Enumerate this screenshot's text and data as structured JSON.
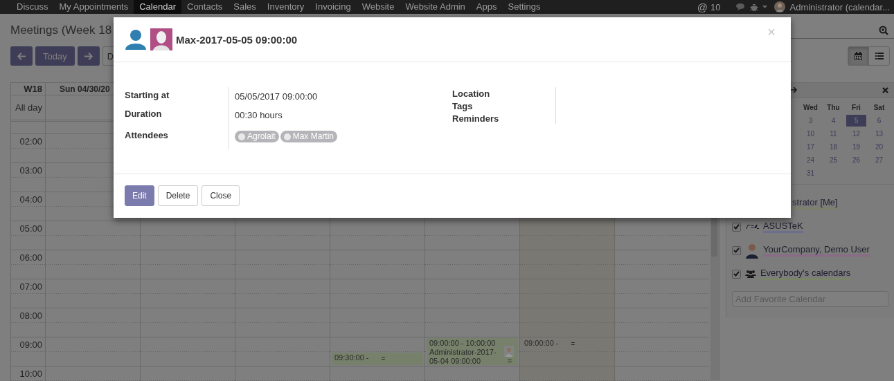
{
  "navbar": {
    "menu": [
      {
        "label": "Discuss",
        "selected": false
      },
      {
        "label": "My Appointments",
        "selected": false
      },
      {
        "label": "Calendar",
        "selected": true
      },
      {
        "label": "Contacts",
        "selected": false
      },
      {
        "label": "Sales",
        "selected": false
      },
      {
        "label": "Inventory",
        "selected": false
      },
      {
        "label": "Invoicing",
        "selected": false
      },
      {
        "label": "Website",
        "selected": false
      },
      {
        "label": "Website Admin",
        "selected": false
      },
      {
        "label": "Apps",
        "selected": false
      },
      {
        "label": "Settings",
        "selected": false
      }
    ],
    "mention_icon": "@",
    "mention_count": "10",
    "user": "Administrator (calendar..."
  },
  "control_panel": {
    "title": "Meetings (Week 18",
    "today": "Today",
    "scale": "D",
    "views": [
      {
        "kind": "calendar",
        "selected": true
      },
      {
        "kind": "list",
        "selected": false
      }
    ]
  },
  "calendar": {
    "week": "W18",
    "all_day": "All day",
    "days": [
      {
        "label": "Sun 04/30/20",
        "today": false
      },
      {
        "today": false
      },
      {
        "today": false
      },
      {
        "today": false,
        "events": [
          {
            "kind": "second-half",
            "time": "09:30:00 -",
            "handle": "=",
            "color": "#76806a"
          }
        ]
      },
      {
        "today": false,
        "events": [
          {
            "kind": "full-hour",
            "time": "09:00:00 - 10:00:00",
            "title": "Administrator-2017-05-04 09:00:00",
            "handle": "=",
            "avatar": true,
            "color": "#76806a"
          }
        ]
      },
      {
        "today": true,
        "events": [
          {
            "kind": "first-half",
            "time": "09:00:00 -",
            "handle": "="
          }
        ]
      },
      {
        "today": false
      }
    ],
    "hours": [
      "02:00",
      "03:00",
      "04:00",
      "05:00",
      "06:00",
      "07:00",
      "08:00",
      "09:00",
      "10:00"
    ]
  },
  "mini_calendar": {
    "headers": [
      "Wed",
      "Thu",
      "Fri",
      "Sat"
    ],
    "weeks": [
      [
        {
          "label": "3",
          "selected": false
        },
        {
          "label": "4",
          "selected": false
        },
        {
          "label": "5",
          "selected": true
        },
        {
          "label": "6",
          "selected": false
        }
      ],
      [
        {
          "label": "10",
          "selected": false
        },
        {
          "label": "11",
          "selected": false
        },
        {
          "label": "12",
          "selected": false
        },
        {
          "label": "13",
          "selected": false
        }
      ],
      [
        {
          "label": "17",
          "selected": false
        },
        {
          "label": "18",
          "selected": false
        },
        {
          "label": "19",
          "selected": false
        },
        {
          "label": "20",
          "selected": false
        }
      ],
      [
        {
          "label": "24",
          "selected": false
        },
        {
          "label": "25",
          "selected": false
        },
        {
          "label": "26",
          "selected": false
        },
        {
          "label": "27",
          "selected": false
        }
      ],
      [
        {
          "label": "31",
          "selected": false
        }
      ]
    ]
  },
  "filters": [
    {
      "kind": "me",
      "label": "strator [Me]",
      "color": "#7a8068"
    },
    {
      "kind": "logo",
      "label": "ASUSTeK",
      "checked": true,
      "color": "#6c6e8e"
    },
    {
      "kind": "avatar",
      "label": "YourCompany, Demo User",
      "checked": true,
      "color": "#8a6a86"
    },
    {
      "kind": "group",
      "label": "Everybody's calendars",
      "checked": true,
      "color": "#7a8466"
    }
  ],
  "favorite_placeholder": "Add Favorite Calendar",
  "modal": {
    "title": "Max-2017-05-05 09:00:00",
    "close": "×",
    "fields_left": [
      {
        "label": "Starting at",
        "value": "05/05/2017 09:00:00"
      },
      {
        "label": "Duration",
        "value": "00:30 hours"
      },
      {
        "label": "Attendees",
        "tags": [
          "Agrolait",
          "Max Martin"
        ]
      }
    ],
    "fields_right": [
      "Location",
      "Tags",
      "Reminders"
    ],
    "buttons": [
      {
        "label": "Edit",
        "kind": "primary"
      },
      {
        "label": "Delete",
        "kind": "default"
      },
      {
        "label": "Close",
        "kind": "default"
      }
    ]
  }
}
